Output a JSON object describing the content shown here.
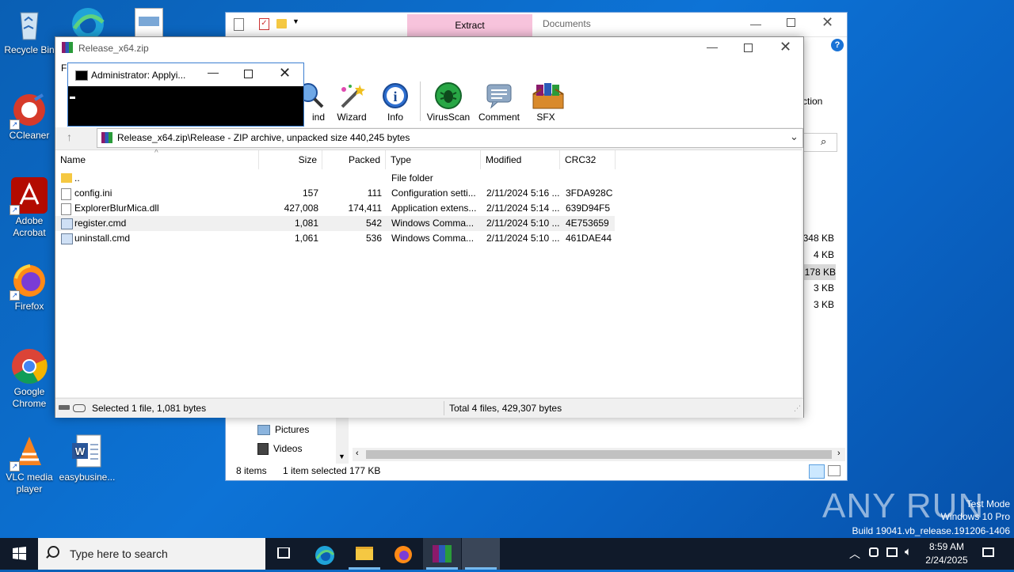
{
  "desktop": {
    "icons": [
      {
        "label": "Recycle Bin",
        "icon": "recycle-bin-icon"
      },
      {
        "label": "CCleaner",
        "icon": "ccleaner-icon"
      },
      {
        "label": "Adobe Acrobat",
        "icon": "acrobat-icon"
      },
      {
        "label": "Firefox",
        "icon": "firefox-icon"
      },
      {
        "label": "Google Chrome",
        "icon": "chrome-icon"
      },
      {
        "label": "VLC media player",
        "icon": "vlc-icon"
      },
      {
        "label": "easybusine...",
        "icon": "word-doc-icon"
      }
    ],
    "watermark": {
      "brand": "ANY RUN",
      "line1": "Test Mode",
      "line2": "Windows 10 Pro",
      "line3": "Build 19041.vb_release.191206-1406"
    }
  },
  "explorer": {
    "tab_extract": "Extract",
    "tab_documents": "Documents",
    "ribbon_partial": "ction",
    "sidebar": [
      {
        "label": "Pictures",
        "icon": "pictures-folder-icon"
      },
      {
        "label": "Videos",
        "icon": "videos-folder-icon"
      }
    ],
    "sizes": [
      "348 KB",
      "4 KB",
      "178 KB",
      "3 KB",
      "3 KB"
    ],
    "status_items": "8 items",
    "status_selected": "1 item selected",
    "status_size": "177 KB"
  },
  "winrar": {
    "title": "Release_x64.zip",
    "menu_partial": "Fi",
    "toolbar": [
      {
        "label": "ind",
        "icon": "find-icon"
      },
      {
        "label": "Wizard",
        "icon": "wizard-icon"
      },
      {
        "label": "Info",
        "icon": "info-icon"
      },
      {
        "label": "VirusScan",
        "icon": "virusscan-icon"
      },
      {
        "label": "Comment",
        "icon": "comment-icon"
      },
      {
        "label": "SFX",
        "icon": "sfx-icon"
      }
    ],
    "path": "Release_x64.zip\\Release - ZIP archive, unpacked size 440,245 bytes",
    "columns": {
      "name": "Name",
      "size": "Size",
      "packed": "Packed",
      "type": "Type",
      "modified": "Modified",
      "crc": "CRC32"
    },
    "files": [
      {
        "name": "..",
        "size": "",
        "packed": "",
        "type": "File folder",
        "modified": "",
        "crc": "",
        "icon": "folder-icon"
      },
      {
        "name": "config.ini",
        "size": "157",
        "packed": "111",
        "type": "Configuration setti...",
        "modified": "2/11/2024 5:16 ...",
        "crc": "3FDA928C",
        "icon": "ini-file-icon"
      },
      {
        "name": "ExplorerBlurMica.dll",
        "size": "427,008",
        "packed": "174,411",
        "type": "Application extens...",
        "modified": "2/11/2024 5:14 ...",
        "crc": "639D94F5",
        "icon": "dll-file-icon"
      },
      {
        "name": "register.cmd",
        "size": "1,081",
        "packed": "542",
        "type": "Windows Comma...",
        "modified": "2/11/2024 5:10 ...",
        "crc": "4E753659",
        "icon": "cmd-file-icon"
      },
      {
        "name": "uninstall.cmd",
        "size": "1,061",
        "packed": "536",
        "type": "Windows Comma...",
        "modified": "2/11/2024 5:10 ...",
        "crc": "461DAE44",
        "icon": "cmd-file-icon"
      }
    ],
    "selected_row": 3,
    "status_left": "Selected 1 file, 1,081 bytes",
    "status_right": "Total 4 files, 429,307 bytes"
  },
  "cmd": {
    "title": "Administrator:  Applyi..."
  },
  "taskbar": {
    "search_placeholder": "Type here to search",
    "time": "8:59 AM",
    "date": "2/24/2025"
  },
  "colors": {
    "desktop": "#0a63c4",
    "taskbar": "#101a2a",
    "selection": "#cce8ff",
    "extract_tab": "#f7c3dc"
  }
}
